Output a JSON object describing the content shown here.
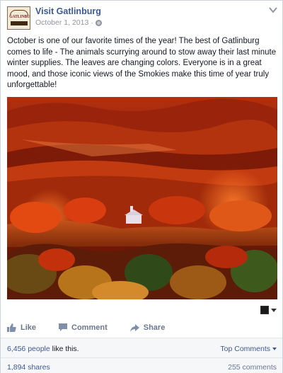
{
  "post": {
    "page_name": "Visit Gatlinburg",
    "logo_text": "GATLINBURG",
    "date": "October 1, 2013",
    "date_separator": "·",
    "audience_icon": "globe-icon",
    "message": "October is one of our favorite times of the year! The best of Gatlinburg comes to life - The animals scurrying around to stow away their last minute winter supplies. The leaves are changing colors. Everyone is in a great mood, and those iconic views of the Smokies make this time of year truly unforgettable!"
  },
  "actions": {
    "like": "Like",
    "comment": "Comment",
    "share": "Share"
  },
  "stats": {
    "likes_count": "6,456 people",
    "likes_rest": " like this.",
    "top_comments": "Top Comments",
    "shares": "1,894 shares",
    "comments": "255 comments"
  },
  "colors": {
    "link_blue": "#3b5998",
    "muted_gray": "#90949c",
    "foliage_red": "#c8290c",
    "foliage_orange": "#e8621a"
  }
}
